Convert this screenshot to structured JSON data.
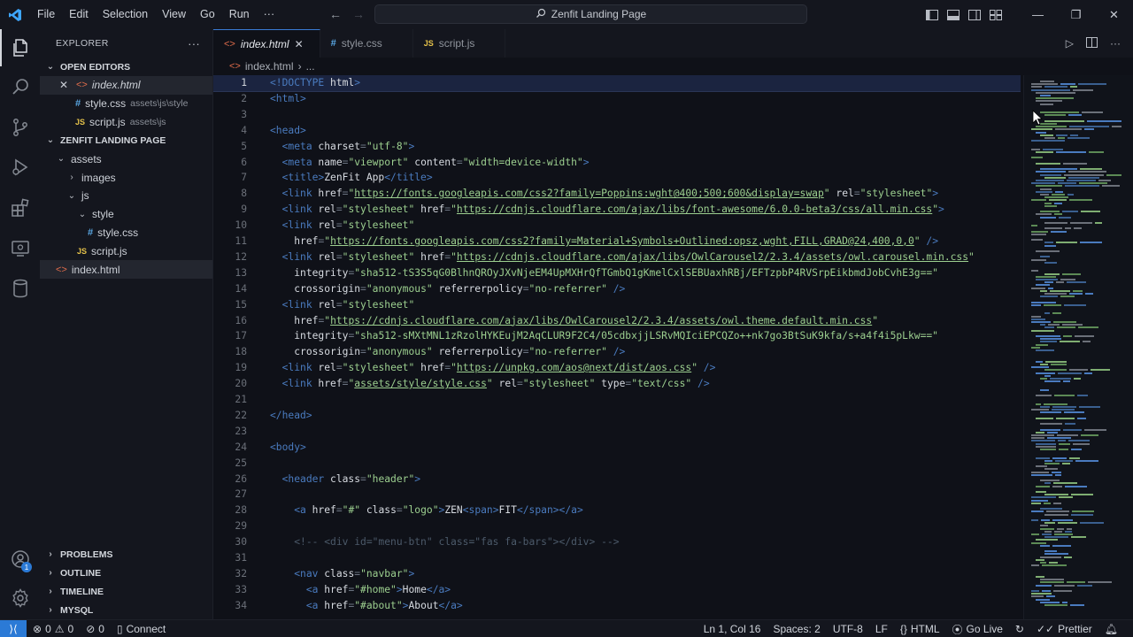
{
  "titlebar": {
    "menu": [
      "File",
      "Edit",
      "Selection",
      "View",
      "Go",
      "Run",
      "···"
    ],
    "search_title": "Zenfit Landing Page"
  },
  "sidebar": {
    "explorer_label": "EXPLORER",
    "more": "···",
    "open_editors_label": "OPEN EDITORS",
    "open_editors": [
      {
        "name": "index.html",
        "path": "",
        "type": "html",
        "active": true
      },
      {
        "name": "style.css",
        "path": "assets\\js\\style",
        "type": "css"
      },
      {
        "name": "script.js",
        "path": "assets\\js",
        "type": "js"
      }
    ],
    "project_label": "ZENFIT LANDING PAGE",
    "tree": [
      {
        "name": "assets",
        "kind": "folder",
        "depth": 1,
        "open": true
      },
      {
        "name": "images",
        "kind": "folder",
        "depth": 2,
        "open": false
      },
      {
        "name": "js",
        "kind": "folder",
        "depth": 2,
        "open": true
      },
      {
        "name": "style",
        "kind": "folder",
        "depth": 3,
        "open": true
      },
      {
        "name": "style.css",
        "kind": "css",
        "depth": 4
      },
      {
        "name": "script.js",
        "kind": "js",
        "depth": 3
      },
      {
        "name": "index.html",
        "kind": "html",
        "depth": 1,
        "selected": true
      }
    ],
    "bottom_sections": [
      "PROBLEMS",
      "OUTLINE",
      "TIMELINE",
      "MYSQL"
    ]
  },
  "tabs": [
    {
      "label": "index.html",
      "icon": "html",
      "active": true
    },
    {
      "label": "style.css",
      "icon": "css",
      "active": false
    },
    {
      "label": "script.js",
      "icon": "js",
      "active": false
    }
  ],
  "breadcrumb": {
    "file": "index.html",
    "rest": "..."
  },
  "code_lines": [
    [
      [
        "doc",
        "<!DOCTYPE"
      ],
      [
        "t",
        " html"
      ],
      [
        "doc",
        ">"
      ]
    ],
    [
      [
        "tag",
        "<html>"
      ]
    ],
    [],
    [
      [
        "tag",
        "<head>"
      ]
    ],
    [
      [
        "s",
        "  "
      ],
      [
        "tag",
        "<meta"
      ],
      [
        "a",
        " charset"
      ],
      [
        "p",
        "="
      ],
      [
        "s2",
        "\"utf-8\""
      ],
      [
        "tag",
        ">"
      ]
    ],
    [
      [
        "s",
        "  "
      ],
      [
        "tag",
        "<meta"
      ],
      [
        "a",
        " name"
      ],
      [
        "p",
        "="
      ],
      [
        "s2",
        "\"viewport\""
      ],
      [
        "a",
        " content"
      ],
      [
        "p",
        "="
      ],
      [
        "s2",
        "\"width=device-width\""
      ],
      [
        "tag",
        ">"
      ]
    ],
    [
      [
        "s",
        "  "
      ],
      [
        "tag",
        "<title>"
      ],
      [
        "t",
        "ZenFit App"
      ],
      [
        "tag",
        "</title>"
      ]
    ],
    [
      [
        "s",
        "  "
      ],
      [
        "tag",
        "<link"
      ],
      [
        "a",
        " href"
      ],
      [
        "p",
        "="
      ],
      [
        "s2",
        "\""
      ],
      [
        "u",
        "https://fonts.googleapis.com/css2?family=Poppins:wght@400;500;600&display=swap"
      ],
      [
        "s2",
        "\""
      ],
      [
        "a",
        " rel"
      ],
      [
        "p",
        "="
      ],
      [
        "s2",
        "\"stylesheet\""
      ],
      [
        "tag",
        ">"
      ]
    ],
    [
      [
        "s",
        "  "
      ],
      [
        "tag",
        "<link"
      ],
      [
        "a",
        " rel"
      ],
      [
        "p",
        "="
      ],
      [
        "s2",
        "\"stylesheet\""
      ],
      [
        "a",
        " href"
      ],
      [
        "p",
        "="
      ],
      [
        "s2",
        "\""
      ],
      [
        "u",
        "https://cdnjs.cloudflare.com/ajax/libs/font-awesome/6.0.0-beta3/css/all.min.css"
      ],
      [
        "s2",
        "\""
      ],
      [
        "tag",
        ">"
      ]
    ],
    [
      [
        "s",
        "  "
      ],
      [
        "tag",
        "<link"
      ],
      [
        "a",
        " rel"
      ],
      [
        "p",
        "="
      ],
      [
        "s2",
        "\"stylesheet\""
      ]
    ],
    [
      [
        "s",
        "    "
      ],
      [
        "a",
        "href"
      ],
      [
        "p",
        "="
      ],
      [
        "s2",
        "\""
      ],
      [
        "u",
        "https://fonts.googleapis.com/css2?family=Material+Symbols+Outlined:opsz,wght,FILL,GRAD@24,400,0,0"
      ],
      [
        "s2",
        "\""
      ],
      [
        "tag",
        " />"
      ]
    ],
    [
      [
        "s",
        "  "
      ],
      [
        "tag",
        "<link"
      ],
      [
        "a",
        " rel"
      ],
      [
        "p",
        "="
      ],
      [
        "s2",
        "\"stylesheet\""
      ],
      [
        "a",
        " href"
      ],
      [
        "p",
        "="
      ],
      [
        "s2",
        "\""
      ],
      [
        "u",
        "https://cdnjs.cloudflare.com/ajax/libs/OwlCarousel2/2.3.4/assets/owl.carousel.min.css"
      ],
      [
        "s2",
        "\""
      ]
    ],
    [
      [
        "s",
        "    "
      ],
      [
        "a",
        "integrity"
      ],
      [
        "p",
        "="
      ],
      [
        "s2",
        "\"sha512-tS3S5qG0BlhnQROyJXvNjeEM4UpMXHrQfTGmbQ1gKmelCxlSEBUaxhRBj/EFTzpbP4RVSrpEikbmdJobCvhE3g==\""
      ]
    ],
    [
      [
        "s",
        "    "
      ],
      [
        "a",
        "crossorigin"
      ],
      [
        "p",
        "="
      ],
      [
        "s2",
        "\"anonymous\""
      ],
      [
        "a",
        " referrerpolicy"
      ],
      [
        "p",
        "="
      ],
      [
        "s2",
        "\"no-referrer\""
      ],
      [
        "tag",
        " />"
      ]
    ],
    [
      [
        "s",
        "  "
      ],
      [
        "tag",
        "<link"
      ],
      [
        "a",
        " rel"
      ],
      [
        "p",
        "="
      ],
      [
        "s2",
        "\"stylesheet\""
      ]
    ],
    [
      [
        "s",
        "    "
      ],
      [
        "a",
        "href"
      ],
      [
        "p",
        "="
      ],
      [
        "s2",
        "\""
      ],
      [
        "u",
        "https://cdnjs.cloudflare.com/ajax/libs/OwlCarousel2/2.3.4/assets/owl.theme.default.min.css"
      ],
      [
        "s2",
        "\""
      ]
    ],
    [
      [
        "s",
        "    "
      ],
      [
        "a",
        "integrity"
      ],
      [
        "p",
        "="
      ],
      [
        "s2",
        "\"sha512-sMXtMNL1zRzolHYKEujM2AqCLUR9F2C4/05cdbxjjLSRvMQIciEPCQZo++nk7go3BtSuK9kfa/s+a4f4i5pLkw==\""
      ]
    ],
    [
      [
        "s",
        "    "
      ],
      [
        "a",
        "crossorigin"
      ],
      [
        "p",
        "="
      ],
      [
        "s2",
        "\"anonymous\""
      ],
      [
        "a",
        " referrerpolicy"
      ],
      [
        "p",
        "="
      ],
      [
        "s2",
        "\"no-referrer\""
      ],
      [
        "tag",
        " />"
      ]
    ],
    [
      [
        "s",
        "  "
      ],
      [
        "tag",
        "<link"
      ],
      [
        "a",
        " rel"
      ],
      [
        "p",
        "="
      ],
      [
        "s2",
        "\"stylesheet\""
      ],
      [
        "a",
        " href"
      ],
      [
        "p",
        "="
      ],
      [
        "s2",
        "\""
      ],
      [
        "u",
        "https://unpkg.com/aos@next/dist/aos.css"
      ],
      [
        "s2",
        "\""
      ],
      [
        "tag",
        " />"
      ]
    ],
    [
      [
        "s",
        "  "
      ],
      [
        "tag",
        "<link"
      ],
      [
        "a",
        " href"
      ],
      [
        "p",
        "="
      ],
      [
        "s2",
        "\""
      ],
      [
        "u",
        "assets/style/style.css"
      ],
      [
        "s2",
        "\""
      ],
      [
        "a",
        " rel"
      ],
      [
        "p",
        "="
      ],
      [
        "s2",
        "\"stylesheet\""
      ],
      [
        "a",
        " type"
      ],
      [
        "p",
        "="
      ],
      [
        "s2",
        "\"text/css\""
      ],
      [
        "tag",
        " />"
      ]
    ],
    [],
    [
      [
        "tag",
        "</head>"
      ]
    ],
    [],
    [
      [
        "tag",
        "<body>"
      ]
    ],
    [],
    [
      [
        "s",
        "  "
      ],
      [
        "tag",
        "<header"
      ],
      [
        "a",
        " class"
      ],
      [
        "p",
        "="
      ],
      [
        "s2",
        "\"header\""
      ],
      [
        "tag",
        ">"
      ]
    ],
    [],
    [
      [
        "s",
        "    "
      ],
      [
        "tag",
        "<a"
      ],
      [
        "a",
        " href"
      ],
      [
        "p",
        "="
      ],
      [
        "s2",
        "\"#\""
      ],
      [
        "a",
        " class"
      ],
      [
        "p",
        "="
      ],
      [
        "s2",
        "\"logo\""
      ],
      [
        "tag",
        ">"
      ],
      [
        "t",
        "ZEN"
      ],
      [
        "tag",
        "<span>"
      ],
      [
        "t",
        "FIT"
      ],
      [
        "tag",
        "</span></a>"
      ]
    ],
    [],
    [
      [
        "s",
        "    "
      ],
      [
        "c",
        "<!-- <div id=\"menu-btn\" class=\"fas fa-bars\"></div> -->"
      ]
    ],
    [],
    [
      [
        "s",
        "    "
      ],
      [
        "tag",
        "<nav"
      ],
      [
        "a",
        " class"
      ],
      [
        "p",
        "="
      ],
      [
        "s2",
        "\"navbar\""
      ],
      [
        "tag",
        ">"
      ]
    ],
    [
      [
        "s",
        "      "
      ],
      [
        "tag",
        "<a"
      ],
      [
        "a",
        " href"
      ],
      [
        "p",
        "="
      ],
      [
        "s2",
        "\"#home\""
      ],
      [
        "tag",
        ">"
      ],
      [
        "t",
        "Home"
      ],
      [
        "tag",
        "</a>"
      ]
    ],
    [
      [
        "s",
        "      "
      ],
      [
        "tag",
        "<a"
      ],
      [
        "a",
        " href"
      ],
      [
        "p",
        "="
      ],
      [
        "s2",
        "\"#about\""
      ],
      [
        "tag",
        ">"
      ],
      [
        "t",
        "About"
      ],
      [
        "tag",
        "</a>"
      ]
    ]
  ],
  "statusbar": {
    "remote_icon": "remote-icon",
    "errors": "0",
    "warnings": "0",
    "ports": "0",
    "connect": "Connect",
    "position": "Ln 1, Col 16",
    "spaces": "Spaces: 2",
    "encoding": "UTF-8",
    "eol": "LF",
    "language": "HTML",
    "go_live": "Go Live",
    "prettier": "Prettier"
  },
  "colors": {
    "accent": "#2b7ad6",
    "background": "#0f1118",
    "tag": "#4a7bbf",
    "string": "#9ccf8f"
  }
}
